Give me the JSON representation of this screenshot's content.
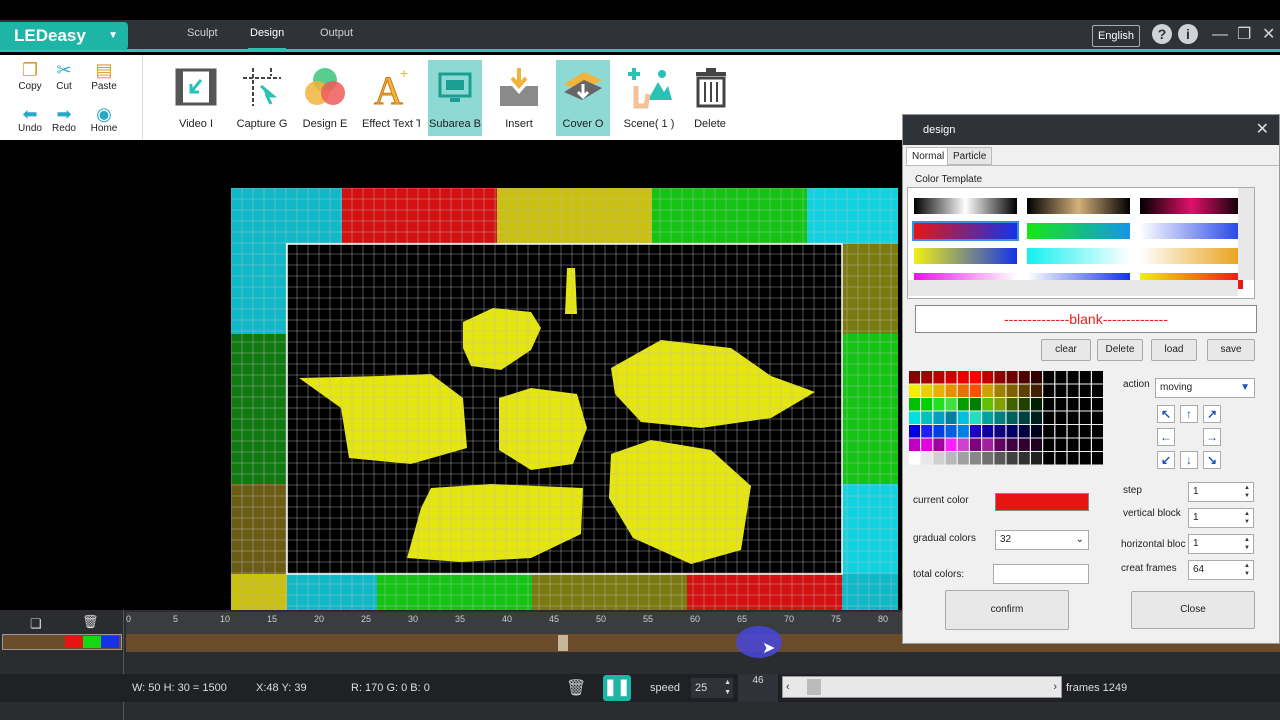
{
  "app": {
    "name": "LEDeasy"
  },
  "menu_tabs": [
    {
      "label": "Sculpt",
      "active": false
    },
    {
      "label": "Design",
      "active": true
    },
    {
      "label": "Output",
      "active": false
    }
  ],
  "language": "English",
  "small_tools": [
    {
      "label": "Copy",
      "icon": "copy-icon",
      "glyph": "❐"
    },
    {
      "label": "Cut",
      "icon": "scissors-icon",
      "glyph": "✂"
    },
    {
      "label": "Paste",
      "icon": "paste-icon",
      "glyph": "📋"
    },
    {
      "label": "Undo",
      "icon": "undo-icon",
      "glyph": "⬅"
    },
    {
      "label": "Redo",
      "icon": "redo-icon",
      "glyph": "➡"
    },
    {
      "label": "Home",
      "icon": "eye-icon",
      "glyph": "◉"
    }
  ],
  "big_tools": [
    {
      "label": "Video I",
      "icon": "video-import-icon",
      "highlight": false
    },
    {
      "label": "Capture G",
      "icon": "capture-icon",
      "highlight": false
    },
    {
      "label": "Design E",
      "icon": "design-effect-icon",
      "highlight": false
    },
    {
      "label": "Effect Text T",
      "icon": "effect-text-icon",
      "highlight": false
    },
    {
      "label": "Subarea B",
      "icon": "subarea-icon",
      "highlight": true
    },
    {
      "label": "Insert",
      "icon": "insert-icon",
      "highlight": false
    },
    {
      "label": "Cover O",
      "icon": "cover-icon",
      "highlight": true
    },
    {
      "label": "Scene( 1 )",
      "icon": "scene-icon",
      "highlight": false
    },
    {
      "label": "Delete",
      "icon": "trash-icon",
      "highlight": false
    }
  ],
  "ruler_labels": [
    "0",
    "5",
    "10",
    "15",
    "20",
    "25",
    "30",
    "35",
    "40",
    "45",
    "50",
    "55",
    "60",
    "65",
    "70",
    "75",
    "80"
  ],
  "status": {
    "size": "W: 50 H: 30 = 1500",
    "pos": "X:48 Y: 39",
    "rgb": "R: 170 G: 0 B: 0",
    "speed_label": "speed",
    "speed": "25",
    "frame": "46",
    "frames": "frames 1249"
  },
  "dialog": {
    "title": "design",
    "tabs": [
      {
        "label": "Normal",
        "active": true
      },
      {
        "label": "Particle",
        "active": false
      }
    ],
    "template_label": "Color Template",
    "blank_label": "--------------blank--------------",
    "buttons": {
      "clear": "clear",
      "delete": "Delete",
      "load": "load",
      "save": "save",
      "confirm": "confirm",
      "close": "Close"
    },
    "action_label": "action",
    "action_value": "moving",
    "current_color_label": "current color",
    "current_color": "#e81414",
    "gradual_label": "gradual colors",
    "gradual_value": "32",
    "total_label": "total colors:",
    "step_label": "step",
    "step_value": "1",
    "vblock_label": "vertical block",
    "vblock_value": "1",
    "hblock_label": "horizontal bloc",
    "hblock_value": "1",
    "frames_label": "creat frames",
    "frames_value": "64"
  },
  "colors": {
    "accent": "#29c2b4",
    "led_yellow": "#e6e60f",
    "current": "#e81414"
  }
}
